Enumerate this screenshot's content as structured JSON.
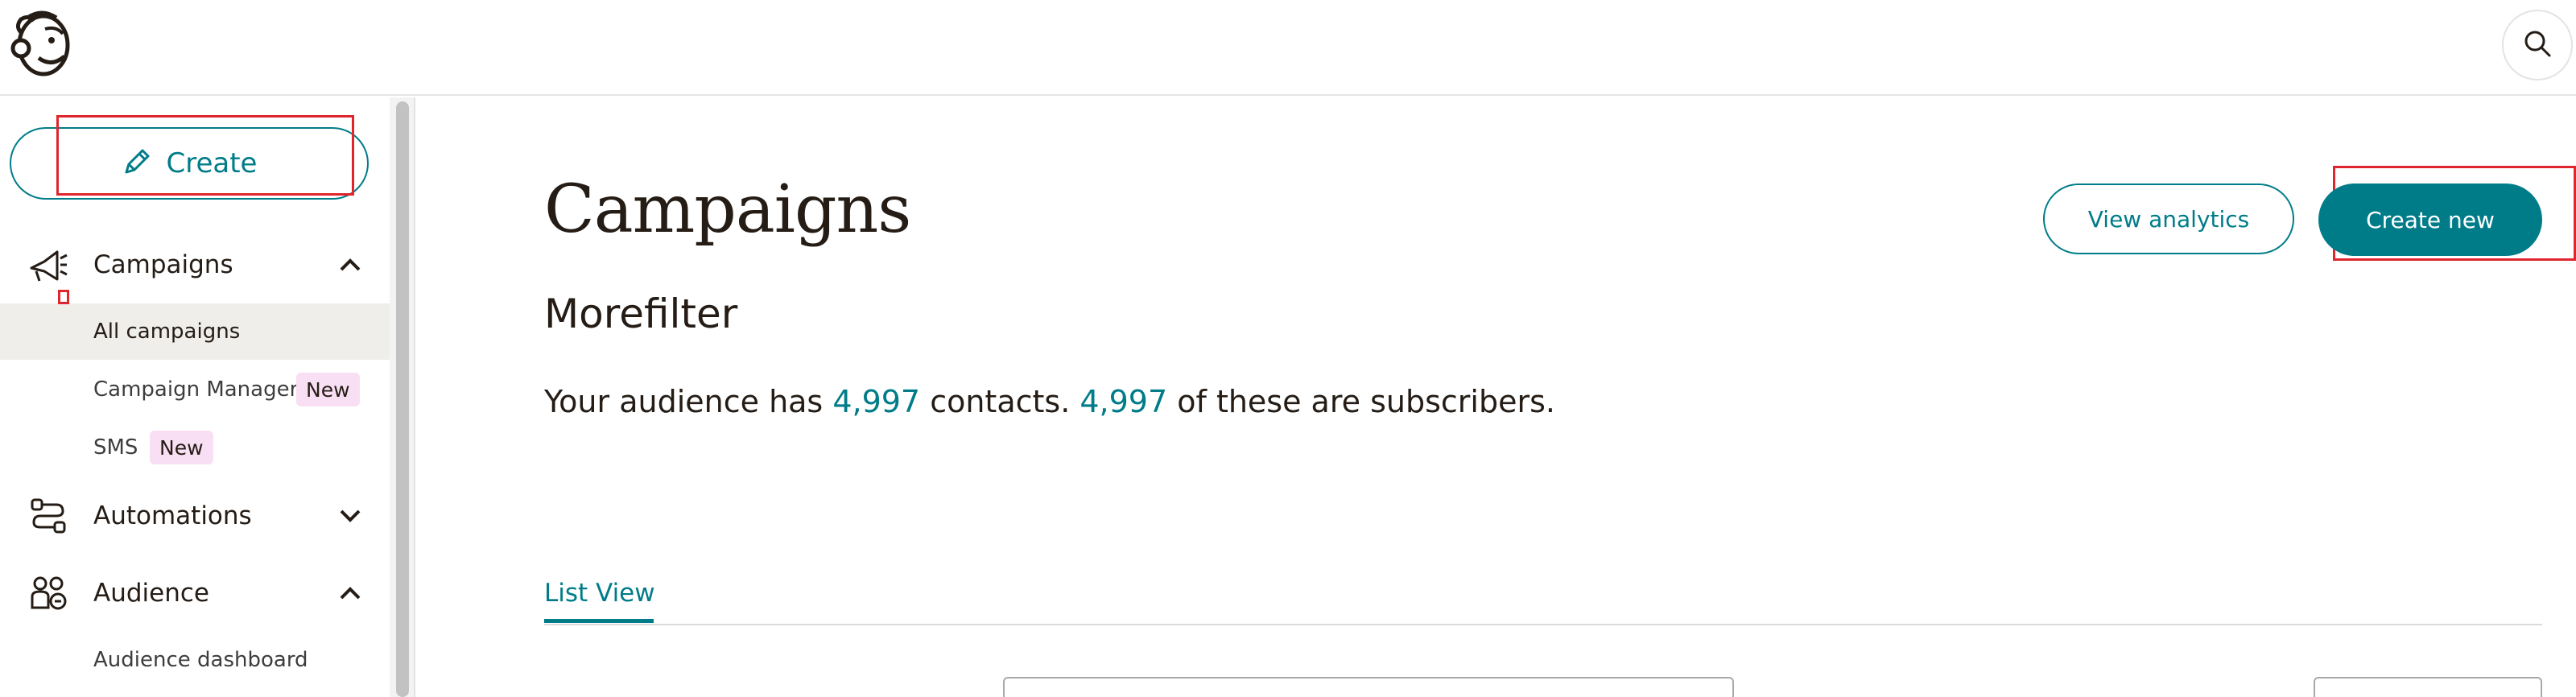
{
  "header": {
    "logo_icon": "mailchimp-freddie-logo",
    "search_icon": "search-icon"
  },
  "sidebar": {
    "create_label": "Create",
    "create_icon": "pencil-icon",
    "groups": [
      {
        "label": "Campaigns",
        "icon": "megaphone-icon",
        "expanded": true,
        "items": [
          {
            "label": "All campaigns",
            "active": true
          },
          {
            "label": "Campaign Manager",
            "badge": "New"
          },
          {
            "label": "SMS",
            "badge": "New"
          }
        ]
      },
      {
        "label": "Automations",
        "icon": "workflow-icon",
        "expanded": false
      },
      {
        "label": "Audience",
        "icon": "audience-icon",
        "expanded": true,
        "items": [
          {
            "label": "Audience dashboard"
          }
        ]
      }
    ]
  },
  "main": {
    "title": "Campaigns",
    "audience_name": "Morefilter",
    "audience_prefix": "Your audience has ",
    "contacts_count": "4,997",
    "audience_middle": " contacts. ",
    "subscribers_count": "4,997",
    "audience_suffix": " of these are subscribers.",
    "view_analytics_label": "View analytics",
    "create_new_label": "Create new",
    "tabs": [
      {
        "label": "List View",
        "active": true
      }
    ]
  },
  "colors": {
    "accent": "#007c89",
    "badge_bg": "#f9dff3",
    "annotation_red": "#e0252c"
  }
}
